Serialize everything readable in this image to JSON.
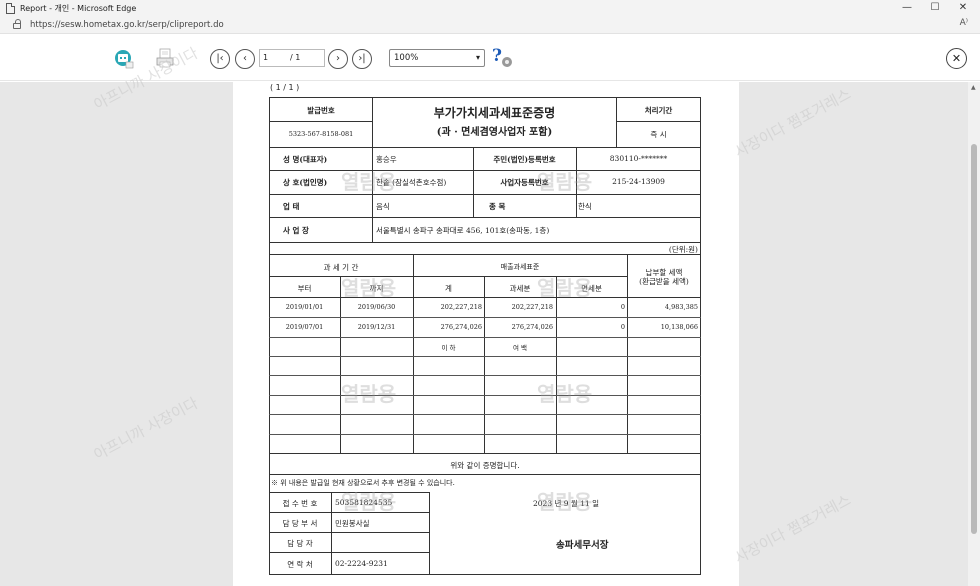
{
  "window": {
    "title": "Report - 개인 - Microsoft Edge",
    "minimize": "—",
    "maximize": "☐",
    "close": "✕"
  },
  "address": {
    "url": "https://sesw.hometax.go.kr/serp/clipreport.do",
    "reader": "A⁾"
  },
  "toolbar": {
    "current_page": "1",
    "total_pages": "/ 1",
    "zoom": "100%",
    "help": "?",
    "close": "✕"
  },
  "page_indicator": "( 1 / 1 )",
  "doc": {
    "issue_no_label": "발급번호",
    "issue_no": "5323-567-8158-081",
    "title": "부가가치세과세표준증명",
    "subtitle": "(과 · 면세겸영사업자 포함)",
    "period_label": "처리기간",
    "period_value": "즉    시",
    "name_label": "성       명(대표자)",
    "name_value": "홍승우",
    "resid_label": "주민(법인)등록번호",
    "resid_value": "830110-*******",
    "company_label": "상       호(법인명)",
    "company_value": "한솥 (잠실석촌호수점)",
    "bizno_label": "사업자등록번호",
    "bizno_value": "215-24-13909",
    "type_label": "업              태",
    "type_value": "음식",
    "item_label": "종              목",
    "item_value": "한식",
    "site_label": "사        업        장",
    "site_value": "서울특별시 송파구 송파대로 456, 101호(송파동, 1층)",
    "unit": "(단위:원)",
    "hdr_period": "과 세 기 간",
    "hdr_sales": "매출과세표준",
    "hdr_tax": "납부할 세액",
    "hdr_tax2": "(환급받을 세액)",
    "hdr_from": "부터",
    "hdr_to": "까지",
    "hdr_total": "계",
    "hdr_taxable": "과세분",
    "hdr_exempt": "면세분",
    "rows": [
      {
        "from": "2019/01/01",
        "to": "2019/06/30",
        "total": "202,227,218",
        "taxable": "202,227,218",
        "exempt": "0",
        "tax": "4,983,385"
      },
      {
        "from": "2019/07/01",
        "to": "2019/12/31",
        "total": "276,274,026",
        "taxable": "276,274,026",
        "exempt": "0",
        "tax": "10,138,066"
      }
    ],
    "blank_left": "이     하",
    "blank_right": "여     백",
    "certify": "위와 같이 증명합니다.",
    "notice": "※ 위 내용은 발급일 현재 상황으로서 추후 변경될 수 있습니다.",
    "receipt_label": "접 수 번 호",
    "receipt_value": "503581824535",
    "dept_label": "담 당 부 서",
    "dept_value": "민원봉사실",
    "staff_label": "담    당    자",
    "staff_value": "",
    "contact_label": "연    락    처",
    "contact_value": "02-2224-9231",
    "date": "2023 년   9 월   11 일",
    "office": "송파세무서장"
  },
  "watermarks": {
    "stamp": "열람용",
    "diagonal": "사장이다 쩜포거레스",
    "diagonal2": "아프니까 사장이다"
  }
}
